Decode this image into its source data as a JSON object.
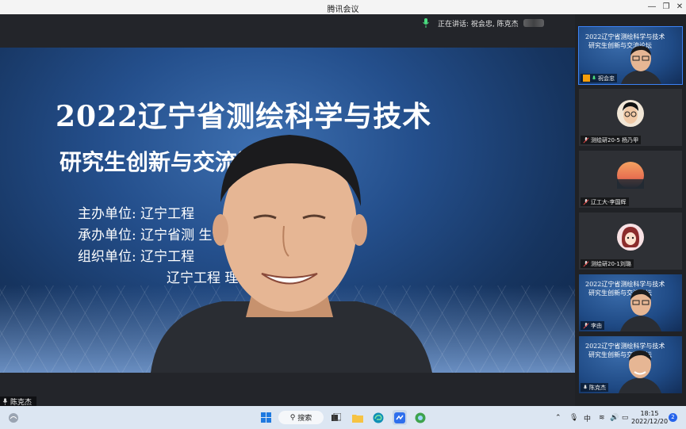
{
  "window": {
    "title": "腾讯会议",
    "controls": [
      "minimize",
      "restore",
      "close"
    ]
  },
  "speaker_bar": {
    "text": "正在讲话: 祝会忠, 陈克杰"
  },
  "main_video": {
    "participant_name": "陈克杰",
    "slide": {
      "line1": "2022辽宁省测绘科学与技术",
      "line2": "研究生创新与交流论坛",
      "line3": "主办单位: 辽宁工程",
      "line4": "承办单位: 辽宁省测      生创新与交流中心",
      "line5": "组织单位: 辽宁工程",
      "line6": "辽宁工程        理科学学院"
    }
  },
  "participants": [
    {
      "name": "祝会忠",
      "type": "slide",
      "mini1": "2022辽宁省测绘科学与技术",
      "mini2": "研究生创新与交流论坛",
      "host": true
    },
    {
      "name": "测绘研20-5 杨乃甲",
      "type": "avatar"
    },
    {
      "name": "辽工大-李国辉",
      "type": "avatar"
    },
    {
      "name": "测绘研20-1刘璐",
      "type": "avatar"
    },
    {
      "name": "李由",
      "type": "slide",
      "mini1": "2022辽宁省测绘科学与技术",
      "mini2": "研究生创新与交流论坛"
    },
    {
      "name": "陈克杰",
      "type": "slide",
      "mini1": "2022辽宁省测绘科学与技术",
      "mini2": "研究生创新与交流论坛"
    }
  ],
  "taskbar": {
    "search_label": "搜索",
    "ime": "中",
    "time": "18:15",
    "date": "2022/12/20",
    "notification_count": "2"
  },
  "colors": {
    "accent": "#3b82f6",
    "stage": "#23252a",
    "slide_blue": "#244f8c"
  }
}
